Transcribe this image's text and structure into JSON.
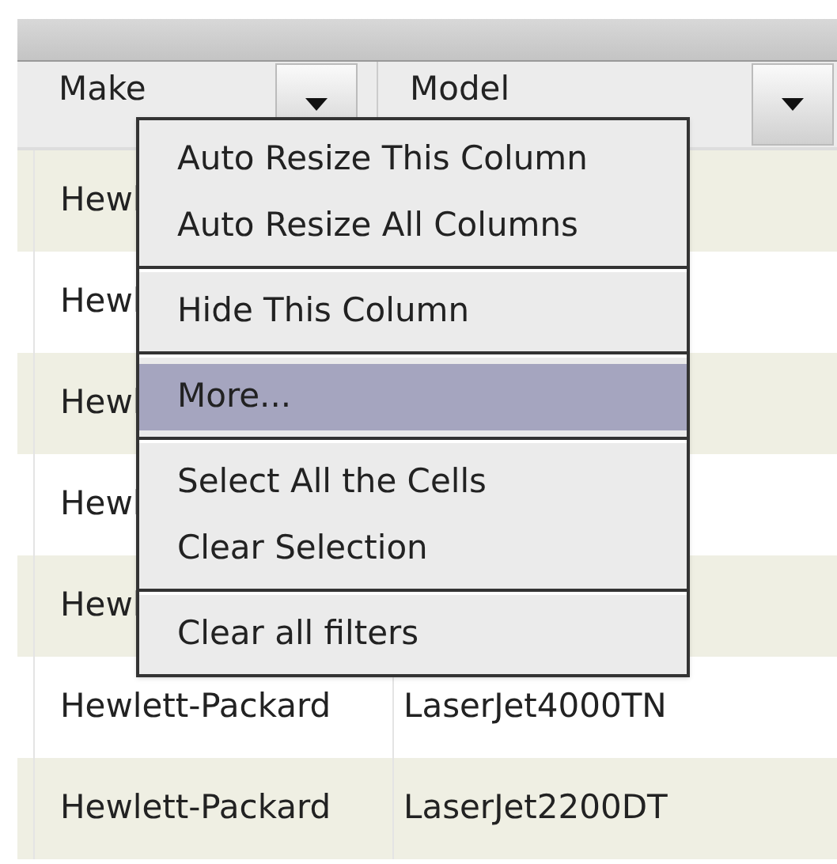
{
  "grid": {
    "columns": [
      {
        "label": "Make"
      },
      {
        "label": "Model"
      }
    ],
    "rows": [
      {
        "make": "Hewl"
      },
      {
        "make": "Hewl"
      },
      {
        "make": "Hewl"
      },
      {
        "make": "Hewl"
      },
      {
        "make": "Hewl"
      },
      {
        "make": "Hewlett-Packard",
        "model": "LaserJet4000TN"
      },
      {
        "make": "Hewlett-Packard",
        "model": "LaserJet2200DT"
      }
    ]
  },
  "context_menu": {
    "groups": [
      [
        {
          "label": "Auto Resize This Column",
          "selected": false
        },
        {
          "label": "Auto Resize All Columns",
          "selected": false
        }
      ],
      [
        {
          "label": "Hide This Column",
          "selected": false
        }
      ],
      [
        {
          "label": "More...",
          "selected": true
        }
      ],
      [
        {
          "label": "Select All the Cells",
          "selected": false
        },
        {
          "label": "Clear Selection",
          "selected": false
        }
      ],
      [
        {
          "label": "Clear all filters",
          "selected": false
        }
      ]
    ]
  }
}
